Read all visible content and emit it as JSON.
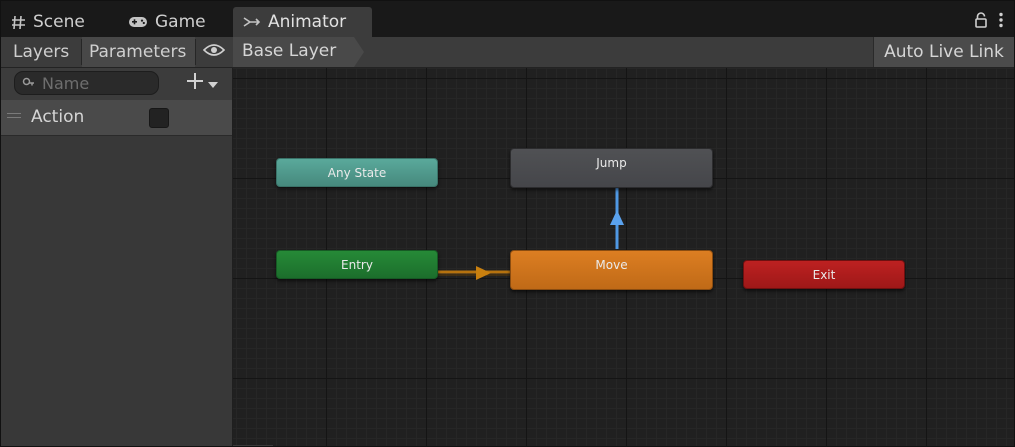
{
  "tabs": [
    {
      "label": "Scene",
      "icon": "grid-icon"
    },
    {
      "label": "Game",
      "icon": "gamepad-icon"
    },
    {
      "label": "Animator",
      "icon": "animator-icon",
      "active": true
    }
  ],
  "left_panel": {
    "tabs": {
      "layers": "Layers",
      "parameters": "Parameters"
    },
    "search": {
      "placeholder": "Name",
      "value": ""
    },
    "parameters": [
      {
        "name": "Action",
        "type": "bool",
        "checked": false
      }
    ]
  },
  "graph": {
    "breadcrumb": "Base Layer",
    "auto_live_link": "Auto Live Link",
    "states": {
      "any_state": {
        "label": "Any State",
        "color": "#4f9c8f"
      },
      "entry": {
        "label": "Entry",
        "color": "#217c32"
      },
      "jump": {
        "label": "Jump",
        "color": "#4a4b4e"
      },
      "move": {
        "label": "Move",
        "color": "#d1751c"
      },
      "exit": {
        "label": "Exit",
        "color": "#b01d1d"
      }
    },
    "transitions": [
      {
        "from": "Entry",
        "to": "Move",
        "color": "#b5720f"
      },
      {
        "from": "Move",
        "to": "Jump",
        "color": "#4f98e3"
      }
    ]
  },
  "colors": {
    "window_bg": "#282828",
    "panel_bg": "#383838",
    "graph_bg": "#202020"
  }
}
